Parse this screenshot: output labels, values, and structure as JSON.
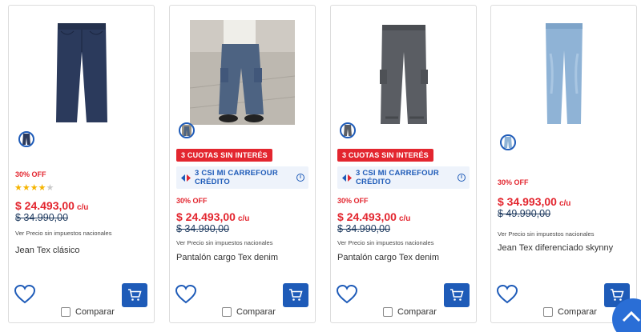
{
  "products": [
    {
      "discount": "30% OFF",
      "rating": 3.5,
      "price": "$ 24.493,00",
      "unit": "c/u",
      "old_price": "$ 34.990,00",
      "tax_note": "Ver Precio sin impuestos nacionales",
      "title": "Jean Tex clásico",
      "compare_label": "Comparar"
    },
    {
      "promo_badge": "3 CUOTAS SIN INTERÉS",
      "credit_line1": "3 CSI MI CARREFOUR",
      "credit_line2": "CRÉDITO",
      "discount": "30% OFF",
      "price": "$ 24.493,00",
      "unit": "c/u",
      "old_price": "$ 34.990,00",
      "tax_note": "Ver Precio sin impuestos nacionales",
      "title": "Pantalón cargo Tex denim",
      "compare_label": "Comparar"
    },
    {
      "promo_badge": "3 CUOTAS SIN INTERÉS",
      "credit_line1": "3 CSI MI CARREFOUR",
      "credit_line2": "CRÉDITO",
      "discount": "30% OFF",
      "price": "$ 24.493,00",
      "unit": "c/u",
      "old_price": "$ 34.990,00",
      "tax_note": "Ver Precio sin impuestos nacionales",
      "title": "Pantalón cargo Tex denim",
      "compare_label": "Comparar"
    },
    {
      "discount": "30% OFF",
      "price": "$ 34.993,00",
      "unit": "c/u",
      "old_price": "$ 49.990,00",
      "tax_note": "Ver Precio sin impuestos nacionales",
      "title": "Jean Tex diferenciado skynny",
      "compare_label": "Comparar"
    }
  ],
  "colors": {
    "brand_blue": "#1e5bb8",
    "sale_red": "#e3262f",
    "star_yellow": "#f5b400"
  },
  "icons": [
    "heart-icon",
    "cart-icon",
    "info-icon",
    "carrefour-logo-icon",
    "scroll-up-icon"
  ]
}
